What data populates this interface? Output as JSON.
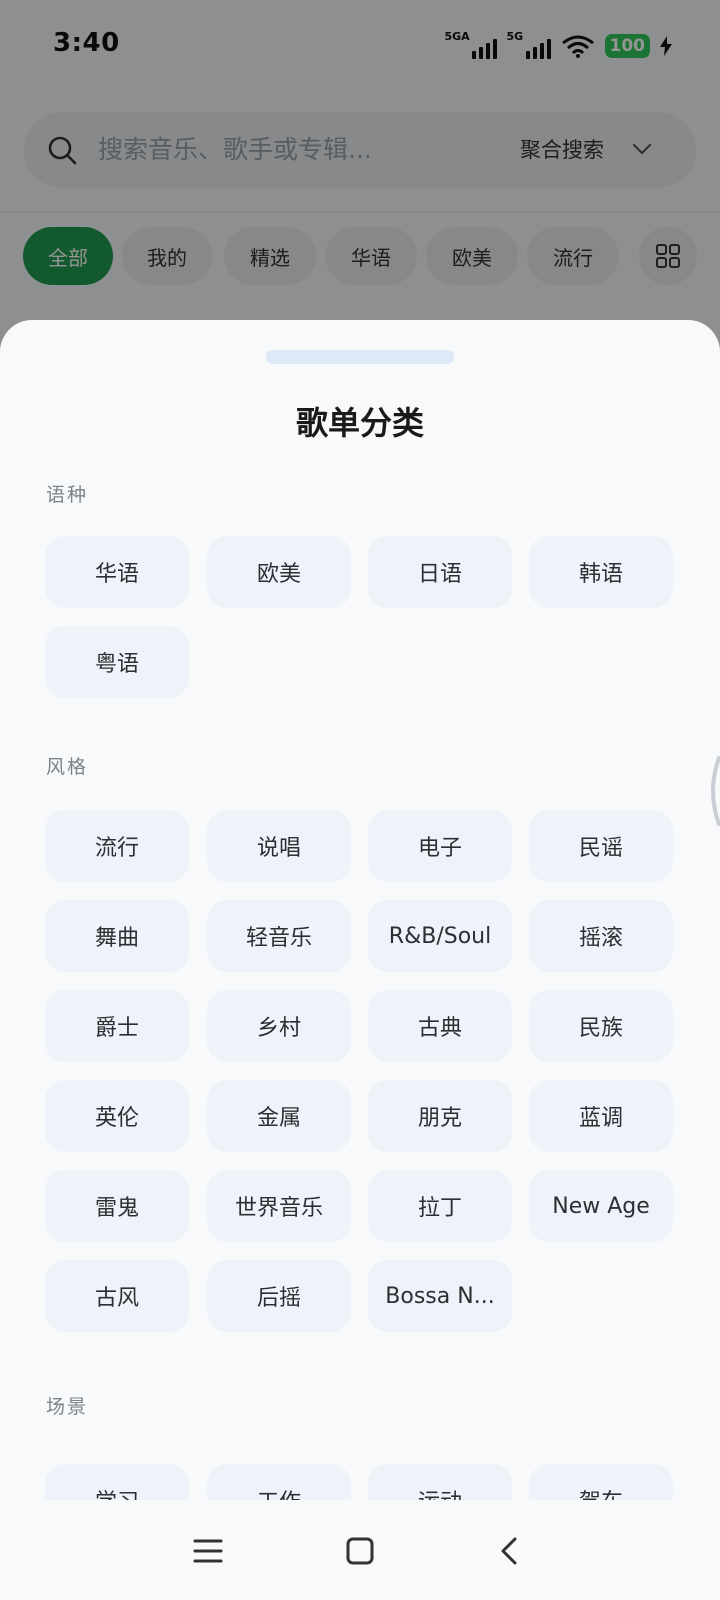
{
  "status_bar": {
    "time": "3:40",
    "signal1_label": "5GA",
    "signal2_label": "5G",
    "battery": "100"
  },
  "search": {
    "placeholder": "搜索音乐、歌手或专辑...",
    "mode": "聚合搜索"
  },
  "top_tabs": [
    "全部",
    "我的",
    "精选",
    "华语",
    "欧美",
    "流行"
  ],
  "sheet": {
    "title": "歌单分类",
    "sections": [
      {
        "label": "语种",
        "items": [
          "华语",
          "欧美",
          "日语",
          "韩语",
          "粤语"
        ]
      },
      {
        "label": "风格",
        "items": [
          "流行",
          "说唱",
          "电子",
          "民谣",
          "舞曲",
          "轻音乐",
          "R&B/Soul",
          "摇滚",
          "爵士",
          "乡村",
          "古典",
          "民族",
          "英伦",
          "金属",
          "朋克",
          "蓝调",
          "雷鬼",
          "世界音乐",
          "拉丁",
          "New Age",
          "古风",
          "后摇",
          "Bossa N..."
        ]
      },
      {
        "label": "场景",
        "items": [
          "学习",
          "工作",
          "运动",
          "驾车"
        ]
      }
    ]
  },
  "colors": {
    "accent": "#1f9b50",
    "tag_bg": "#edf3f9",
    "sheet_bg": "#f7f9fb"
  },
  "icons": [
    "search-icon",
    "chevron-down-icon",
    "grid-icon",
    "menu-icon",
    "home-square-icon",
    "back-icon",
    "wifi-icon",
    "charging-icon"
  ]
}
